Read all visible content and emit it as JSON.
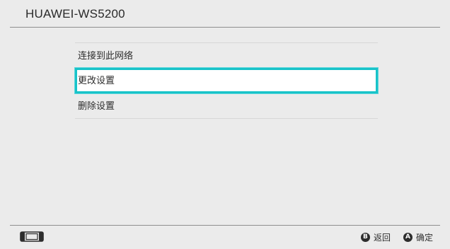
{
  "header": {
    "title": "HUAWEI-WS5200"
  },
  "menu": {
    "items": [
      {
        "label": "连接到此网络",
        "selected": false
      },
      {
        "label": "更改设置",
        "selected": true
      },
      {
        "label": "删除设置",
        "selected": false
      }
    ]
  },
  "footer": {
    "console_icon": "handheld-console-icon",
    "back": {
      "button": "B",
      "label": "返回"
    },
    "confirm": {
      "button": "A",
      "label": "确定"
    }
  },
  "colors": {
    "background": "#ebebeb",
    "selection_border": "#18c3c9",
    "text": "#2d2d2d"
  }
}
